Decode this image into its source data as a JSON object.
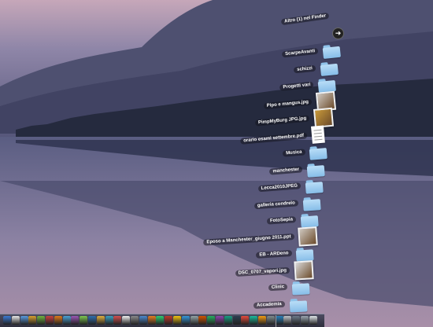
{
  "stack": {
    "open_in_finder": "Altro (1) nel Finder",
    "items": [
      {
        "label": "ScarpeAvanti",
        "kind": "folder"
      },
      {
        "label": "schizzi",
        "kind": "folder"
      },
      {
        "label": "Progetti vari",
        "kind": "folder"
      },
      {
        "label": "Pipo e mangus.jpg",
        "kind": "image"
      },
      {
        "label": "PimpMyBurg JPG.jpg",
        "kind": "image"
      },
      {
        "label": "orario esami settembre.pdf",
        "kind": "document"
      },
      {
        "label": "Musica",
        "kind": "folder"
      },
      {
        "label": "manchester",
        "kind": "folder"
      },
      {
        "label": "Lecca2010JPEG",
        "kind": "folder"
      },
      {
        "label": "galleria condrelo",
        "kind": "folder"
      },
      {
        "label": "FotoSepia",
        "kind": "folder"
      },
      {
        "label": "Eposo a Manchester_giugno 2011.ppt",
        "kind": "image"
      },
      {
        "label": "EB - ARDeno",
        "kind": "folder"
      },
      {
        "label": "DSC_0707_vapori.jpg",
        "kind": "image"
      },
      {
        "label": "Clinic",
        "kind": "folder"
      },
      {
        "label": "Accademia",
        "kind": "folder"
      }
    ]
  },
  "dock": {
    "icon_colors": [
      "#3b7bd4",
      "#e8e8e8",
      "#5a9be0",
      "#d9a030",
      "#6fb33f",
      "#c94040",
      "#e07a1a",
      "#4aa4d8",
      "#9b59b6",
      "#7ec850",
      "#2f6fb0",
      "#e0b040",
      "#3aa0c0",
      "#d45050",
      "#f0f0f0",
      "#8a8a8a",
      "#4c8ad0",
      "#e67e22",
      "#2ecc71",
      "#c0392b",
      "#f1c40f",
      "#3498db",
      "#95a5a6",
      "#d35400",
      "#27ae60",
      "#8e44ad",
      "#16a085",
      "#2c3e50",
      "#e74c3c",
      "#1abc9c",
      "#f39c12",
      "#7f8c8d",
      "#2980b9",
      "#bdc3c7",
      "#6c7a89",
      "#9aa5b0",
      "#dfe6e9"
    ]
  }
}
